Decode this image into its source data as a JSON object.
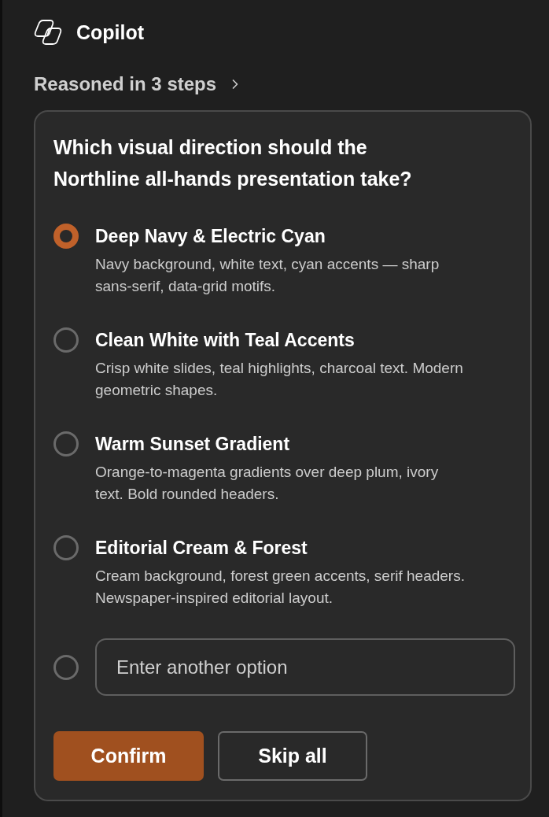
{
  "app": {
    "title": "Copilot"
  },
  "reasoning": {
    "label": "Reasoned in 3 steps",
    "expanded": false
  },
  "question": {
    "prompt": "Which visual direction should the Northline all-hands presentation take?",
    "options": [
      {
        "title": "Deep Navy & Electric Cyan",
        "description": "Navy background, white text, cyan accents — sharp sans-serif, data-grid motifs.",
        "selected": true
      },
      {
        "title": "Clean White with Teal Accents",
        "description": "Crisp white slides, teal highlights, charcoal text. Modern geometric shapes.",
        "selected": false
      },
      {
        "title": "Warm Sunset Gradient",
        "description": "Orange-to-magenta gradients over deep plum, ivory text. Bold rounded headers.",
        "selected": false
      },
      {
        "title": "Editorial Cream & Forest",
        "description": "Cream background, forest green accents, serif headers. Newspaper-inspired editorial layout.",
        "selected": false
      }
    ],
    "other_option": {
      "placeholder": "Enter another option",
      "selected": false
    },
    "buttons": [
      {
        "label": "Confirm",
        "kind": "primary"
      },
      {
        "label": "Skip all",
        "kind": "secondary"
      }
    ]
  }
}
